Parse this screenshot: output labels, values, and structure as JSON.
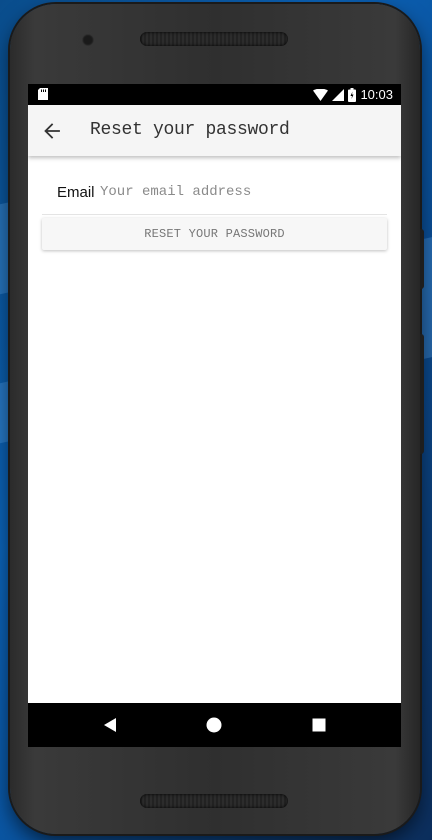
{
  "status_bar": {
    "time": "10:03",
    "icons": [
      "sd-card-icon",
      "wifi-icon",
      "signal-icon",
      "battery-icon"
    ]
  },
  "app_bar": {
    "title": "Reset your password",
    "back_icon": "arrow-back-icon"
  },
  "form": {
    "email_label": "Email",
    "email_placeholder": "Your email address",
    "email_value": "",
    "reset_button_label": "RESET YOUR PASSWORD"
  },
  "nav_bar": {
    "buttons": [
      "back-triangle-icon",
      "home-circle-icon",
      "recents-square-icon"
    ]
  },
  "colors": {
    "app_bar_bg": "#f5f5f5",
    "screen_bg": "#ffffff",
    "status_bar_bg": "#000000",
    "button_bg": "#f7f7f7",
    "button_text": "#777777",
    "desktop_bg": "#0b63b8"
  }
}
